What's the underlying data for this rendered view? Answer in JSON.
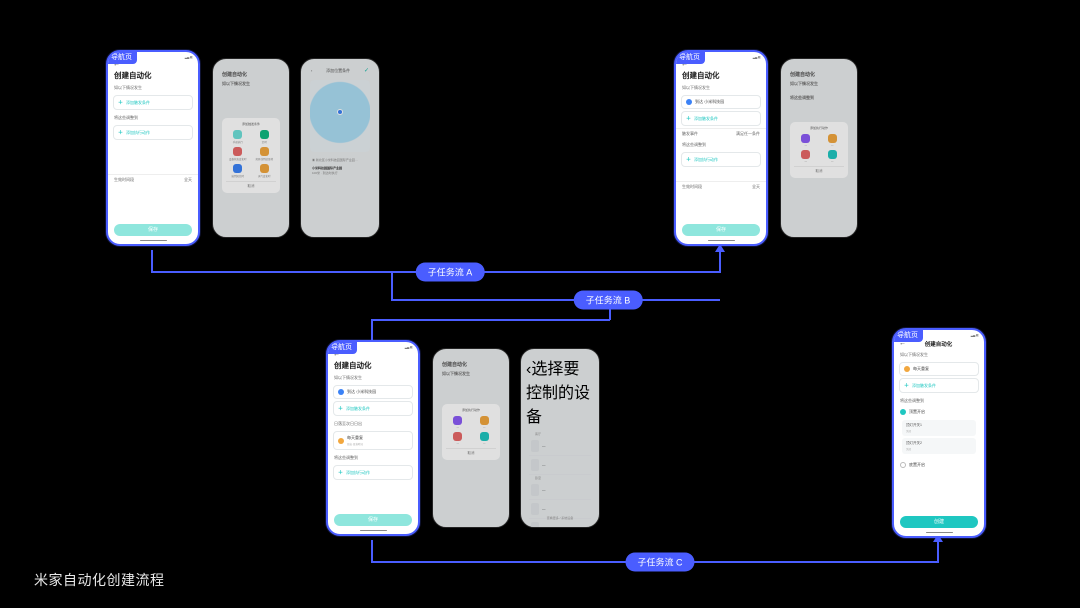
{
  "caption": "米家自动化创建流程",
  "nav_tag": "导航页",
  "flow_labels": {
    "a": "子任务流 A",
    "b": "子任务流 B",
    "c": "子任务流 C"
  },
  "screen_main": {
    "title": "创建自动化",
    "section_if": "如以下情况发生",
    "add_trigger": "添加触发条件",
    "section_then": "将这些调整到",
    "add_action": "添加执行动作",
    "footer_left": "生效时间段",
    "footer_right": "全天",
    "cta": "保存"
  },
  "action_sheet": {
    "title_if": "添加触发条件",
    "title_then": "添加执行动作",
    "cancel": "取消",
    "items": [
      "手动执行",
      "定时",
      "设备状态变化时",
      "离开或到达某地",
      "接到短信时",
      "天气变化时"
    ]
  },
  "map_screen": {
    "header": "添加位置条件",
    "line1": "新北区小米科技园国际产业园…",
    "line2": "小米科技园国际产业园",
    "sub": "100米 · 到达时执行"
  },
  "screen_with_trigger": {
    "trigger_label": "到达 小米科技园",
    "match_condition": "触发事件",
    "match_value": "满足任一条件"
  },
  "screen_b": {
    "section_limit": "日落至次日日出",
    "limit_item": "每天重复",
    "limit_sub": "日出·日落时间"
  },
  "device_list": {
    "title": "选择要控制的设备",
    "rooms": [
      "客厅",
      "卧室",
      "书房"
    ],
    "bottom": "查看更多 / 系统设备"
  },
  "result_screen": {
    "title": "创建自动化",
    "toggle": "顶置开启",
    "item1": "顶灯开关1",
    "item2": "顶灯开关2",
    "off": "关闭",
    "footer_toggle": "底置开启",
    "cta": "创建"
  },
  "icons": {
    "colors": {
      "teal": "#1fc7c1",
      "indigo": "#4a5dff",
      "orange": "#f2a73e",
      "red": "#e86868",
      "blue": "#3b82f6",
      "green2": "#10b981"
    }
  }
}
